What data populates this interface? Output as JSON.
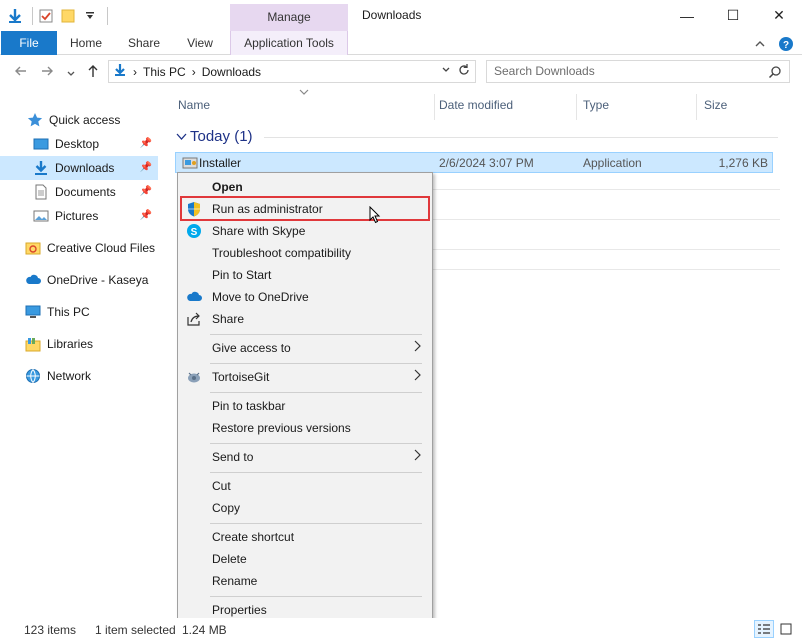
{
  "titlebar": {
    "title": "Downloads",
    "manage_tab": "Manage",
    "minimize": "—",
    "maximize": "☐",
    "close": "✕"
  },
  "ribbon": {
    "tabs": [
      "File",
      "Home",
      "Share",
      "View",
      "Application Tools"
    ]
  },
  "address": {
    "crumbs": [
      "This PC",
      "Downloads"
    ],
    "search_placeholder": "Search Downloads"
  },
  "nav": {
    "quick_access": "Quick access",
    "items": [
      "Desktop",
      "Downloads",
      "Documents",
      "Pictures"
    ],
    "creative_cloud": "Creative Cloud Files",
    "onedrive": "OneDrive - Kaseya",
    "this_pc": "This PC",
    "libraries": "Libraries",
    "network": "Network"
  },
  "columns": {
    "name": "Name",
    "date": "Date modified",
    "type": "Type",
    "size": "Size"
  },
  "group": {
    "title": "Today (1)"
  },
  "file": {
    "name": "Installer",
    "date": "2/6/2024 3:07 PM",
    "type": "Application",
    "size": "1,276 KB"
  },
  "context_menu": {
    "open": "Open",
    "run_admin": "Run as administrator",
    "share_skype": "Share with Skype",
    "troubleshoot": "Troubleshoot compatibility",
    "pin_start": "Pin to Start",
    "move_onedrive": "Move to OneDrive",
    "share": "Share",
    "give_access": "Give access to",
    "tortoisegit": "TortoiseGit",
    "pin_taskbar": "Pin to taskbar",
    "restore": "Restore previous versions",
    "send_to": "Send to",
    "cut": "Cut",
    "copy": "Copy",
    "create_shortcut": "Create shortcut",
    "delete": "Delete",
    "rename": "Rename",
    "properties": "Properties"
  },
  "status": {
    "items": "123 items",
    "selected": "1 item selected",
    "size": "1.24 MB"
  },
  "colors": {
    "accent": "#1979ca",
    "selection": "#cce8ff",
    "highlight_box": "#e0383b",
    "manage_tab": "#e7d8f0"
  }
}
